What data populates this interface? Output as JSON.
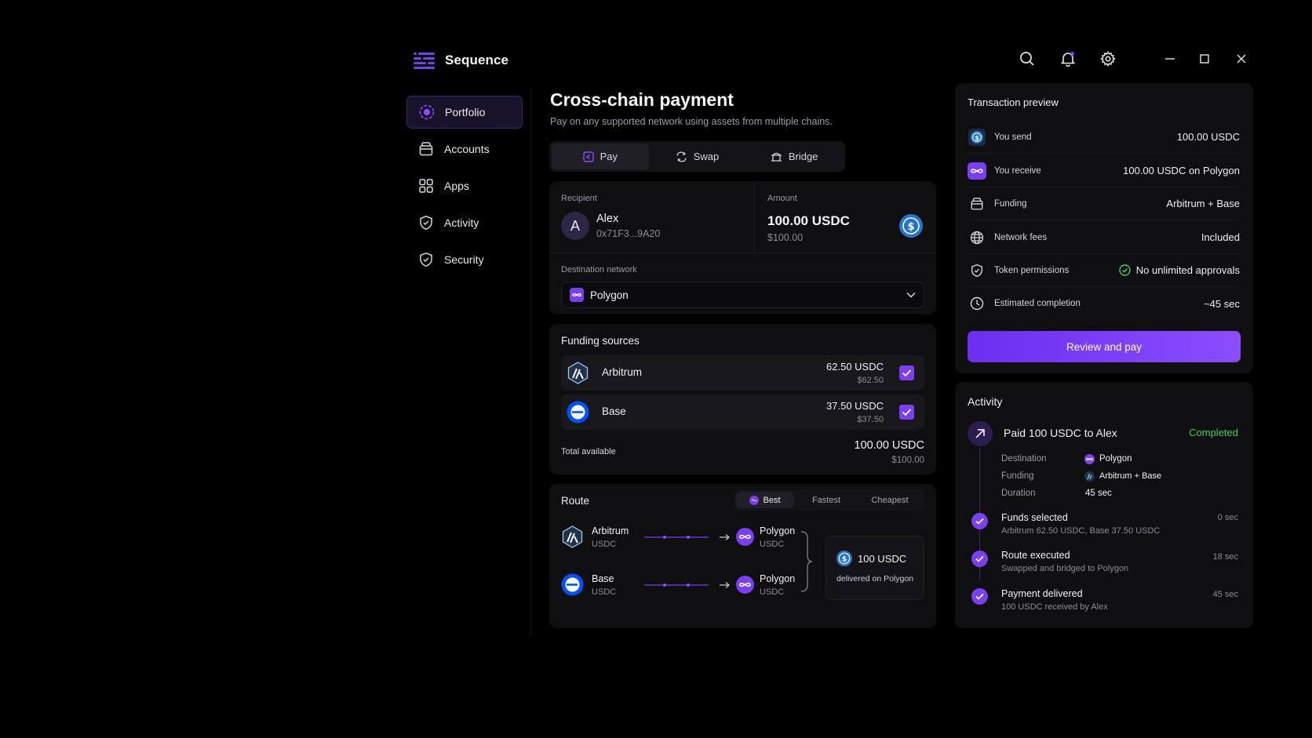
{
  "app": {
    "name": "Sequence"
  },
  "colors": {
    "accent": "#7b3ff2",
    "success": "#3ecf5f",
    "usdc": "#2775ca"
  },
  "sidebar": {
    "items": [
      {
        "label": "Portfolio",
        "icon": "portfolio-icon",
        "active": true
      },
      {
        "label": "Accounts",
        "icon": "wallet-icon"
      },
      {
        "label": "Apps",
        "icon": "apps-grid-icon"
      },
      {
        "label": "Activity",
        "icon": "shield-icon"
      },
      {
        "label": "Security",
        "icon": "shield-check-icon"
      }
    ]
  },
  "main": {
    "title": "Cross-chain payment",
    "subtitle": "Pay on any supported network using assets from multiple chains.",
    "tabs": [
      {
        "label": "Pay",
        "active": true
      },
      {
        "label": "Swap"
      },
      {
        "label": "Bridge"
      }
    ],
    "recipient": {
      "label": "Recipient",
      "avatar": "A",
      "name": "Alex",
      "address": "0x71F3...9A20"
    },
    "amount": {
      "label": "Amount",
      "value": "100.00 USDC",
      "fiat": "$100.00"
    },
    "destination": {
      "label": "Destination network",
      "value": "Polygon"
    },
    "funding": {
      "title": "Funding sources",
      "sources": [
        {
          "name": "Arbitrum",
          "amount": "62.50 USDC",
          "fiat": "$62.50",
          "checked": true
        },
        {
          "name": "Base",
          "amount": "37.50 USDC",
          "fiat": "$37.50",
          "checked": true
        }
      ],
      "total_label": "Total available",
      "total": "100.00 USDC",
      "total_fiat": "$100.00"
    },
    "route": {
      "title": "Route",
      "options": [
        {
          "label": "Best",
          "active": true
        },
        {
          "label": "Fastest"
        },
        {
          "label": "Cheapest"
        }
      ],
      "paths": [
        {
          "from": "Arbitrum",
          "from_token": "USDC",
          "to": "Polygon",
          "to_token": "USDC"
        },
        {
          "from": "Base",
          "from_token": "USDC",
          "to": "Polygon",
          "to_token": "USDC"
        }
      ],
      "result_amount": "100 USDC",
      "result_note": "delivered on Polygon"
    }
  },
  "preview": {
    "title": "Transaction preview",
    "rows": [
      {
        "key": "You send",
        "value": "100.00 USDC"
      },
      {
        "key": "You receive",
        "value": "100.00 USDC on Polygon"
      },
      {
        "key": "Funding",
        "value": "Arbitrum + Base"
      },
      {
        "key": "Network fees",
        "value": "Included"
      },
      {
        "key": "Token permissions",
        "value": "No unlimited approvals"
      },
      {
        "key": "Estimated completion",
        "value": "~45 sec"
      }
    ],
    "cta": "Review and pay"
  },
  "activity": {
    "title": "Activity",
    "headline": "Paid 100 USDC to Alex",
    "status": "Completed",
    "details": [
      {
        "key": "Destination",
        "value": "Polygon"
      },
      {
        "key": "Funding",
        "value": "Arbitrum + Base"
      },
      {
        "key": "Duration",
        "value": "45 sec"
      }
    ],
    "steps": [
      {
        "title": "Funds selected",
        "sub": "Arbitrum 62.50 USDC, Base 37.50 USDC",
        "time": "0 sec"
      },
      {
        "title": "Route executed",
        "sub": "Swapped and bridged to Polygon",
        "time": "18 sec"
      },
      {
        "title": "Payment delivered",
        "sub": "100 USDC received by Alex",
        "time": "45 sec"
      }
    ]
  }
}
